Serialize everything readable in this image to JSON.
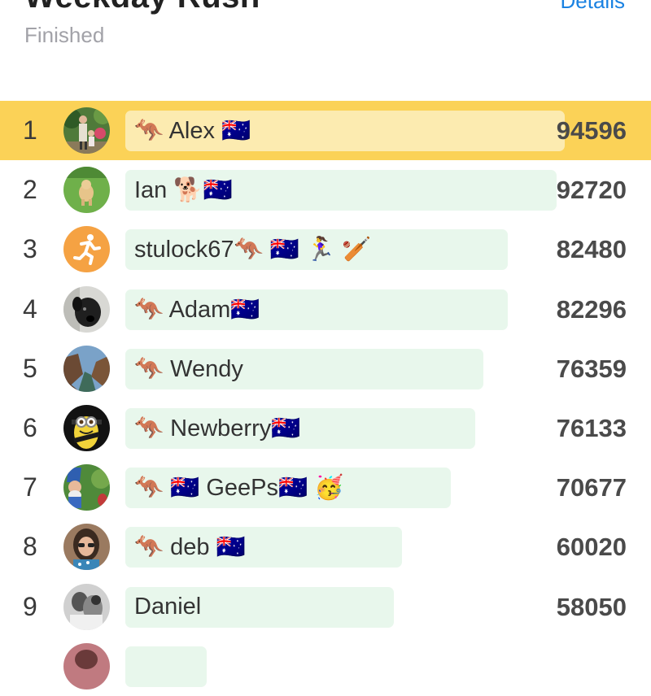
{
  "header": {
    "title": "Weekday Rush",
    "details_label": "Details",
    "status": "Finished"
  },
  "leaderboard": [
    {
      "rank": "1",
      "name": "🦘 Alex 🇦🇺",
      "score": "94596",
      "bar": 0.54,
      "highlight": true,
      "avatar": "photo-garden"
    },
    {
      "rank": "2",
      "name": "Ian 🐕🇦🇺",
      "score": "92720",
      "bar": 0.53,
      "highlight": false,
      "avatar": "photo-dog-lawn"
    },
    {
      "rank": "3",
      "name": "stulock67🦘 🇦🇺 🏃‍♀️ 🏏",
      "score": "82480",
      "bar": 0.47,
      "highlight": false,
      "avatar": "running-icon"
    },
    {
      "rank": "4",
      "name": "🦘 Adam🇦🇺",
      "score": "82296",
      "bar": 0.47,
      "highlight": false,
      "avatar": "photo-black-dog"
    },
    {
      "rank": "5",
      "name": "🦘 Wendy",
      "score": "76359",
      "bar": 0.44,
      "highlight": false,
      "avatar": "photo-canyon"
    },
    {
      "rank": "6",
      "name": "🦘 Newberry🇦🇺",
      "score": "76133",
      "bar": 0.43,
      "highlight": false,
      "avatar": "minion"
    },
    {
      "rank": "7",
      "name": "🦘 🇦🇺 GeePs🇦🇺 🥳",
      "score": "70677",
      "bar": 0.4,
      "highlight": false,
      "avatar": "photo-gnome"
    },
    {
      "rank": "8",
      "name": "🦘 deb 🇦🇺",
      "score": "60020",
      "bar": 0.34,
      "highlight": false,
      "avatar": "photo-woman-glasses"
    },
    {
      "rank": "9",
      "name": "Daniel",
      "score": "58050",
      "bar": 0.33,
      "highlight": false,
      "avatar": "photo-bw"
    },
    {
      "rank": "",
      "name": "",
      "score": "",
      "bar": 0.1,
      "highlight": false,
      "avatar": "photo-partial"
    }
  ],
  "colors": {
    "highlight": "#fbd257",
    "bar": "#e8f7ec",
    "highlight_bar": "#fcebb0",
    "link": "#1a82e2"
  }
}
